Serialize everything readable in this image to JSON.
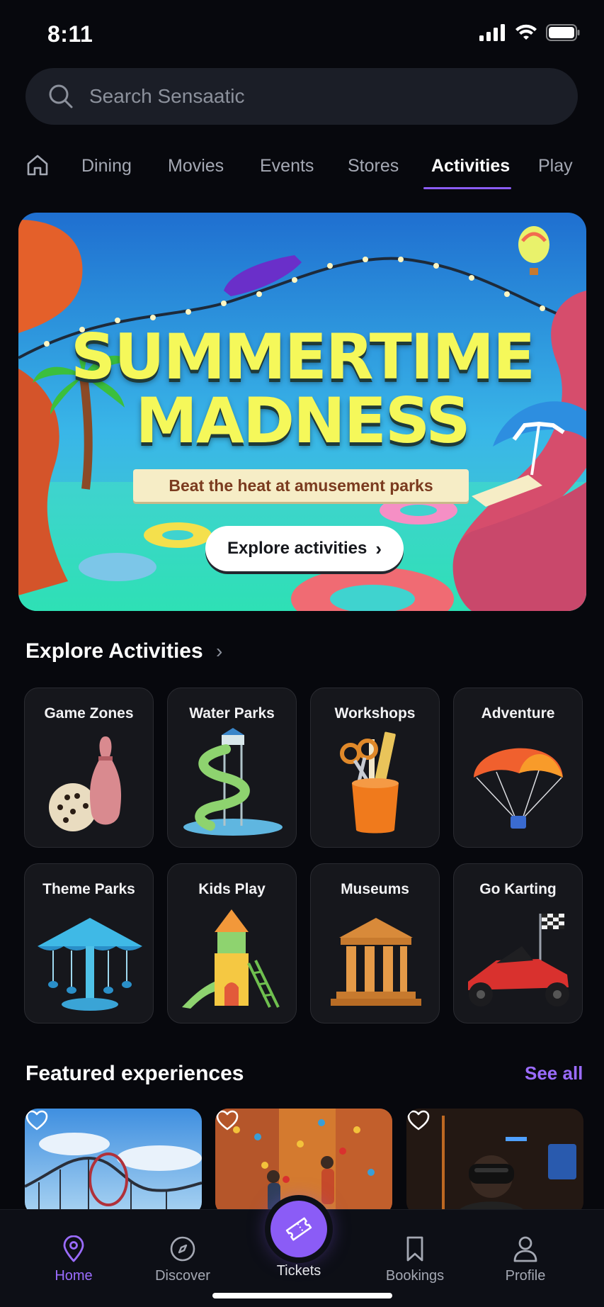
{
  "status_bar": {
    "time": "8:11"
  },
  "search": {
    "placeholder": "Search Sensaatic"
  },
  "tabs": [
    {
      "label": "Dining"
    },
    {
      "label": "Movies"
    },
    {
      "label": "Events"
    },
    {
      "label": "Stores"
    },
    {
      "label": "Activities",
      "active": true
    },
    {
      "label": "Play"
    }
  ],
  "hero": {
    "title_line1": "SUMMERTIME",
    "title_line2": "MADNESS",
    "subtitle": "Beat the heat at amusement parks",
    "cta": "Explore activities"
  },
  "explore": {
    "title": "Explore Activities",
    "items": [
      {
        "label": "Game Zones",
        "icon": "bowling-icon"
      },
      {
        "label": "Water Parks",
        "icon": "water-slide-icon"
      },
      {
        "label": "Workshops",
        "icon": "craft-supplies-icon"
      },
      {
        "label": "Adventure",
        "icon": "parachute-icon"
      },
      {
        "label": "Theme Parks",
        "icon": "carousel-icon"
      },
      {
        "label": "Kids Play",
        "icon": "playhouse-icon"
      },
      {
        "label": "Museums",
        "icon": "museum-icon"
      },
      {
        "label": "Go Karting",
        "icon": "go-kart-icon"
      }
    ]
  },
  "featured": {
    "title": "Featured experiences",
    "see_all": "See all"
  },
  "bottom_nav": {
    "home": "Home",
    "discover": "Discover",
    "tickets": "Tickets",
    "bookings": "Bookings",
    "profile": "Profile"
  },
  "colors": {
    "background": "#07080d",
    "accent": "#8b5cf6",
    "accent_text": "#9b6cff",
    "hero_title": "#f5f85a"
  }
}
